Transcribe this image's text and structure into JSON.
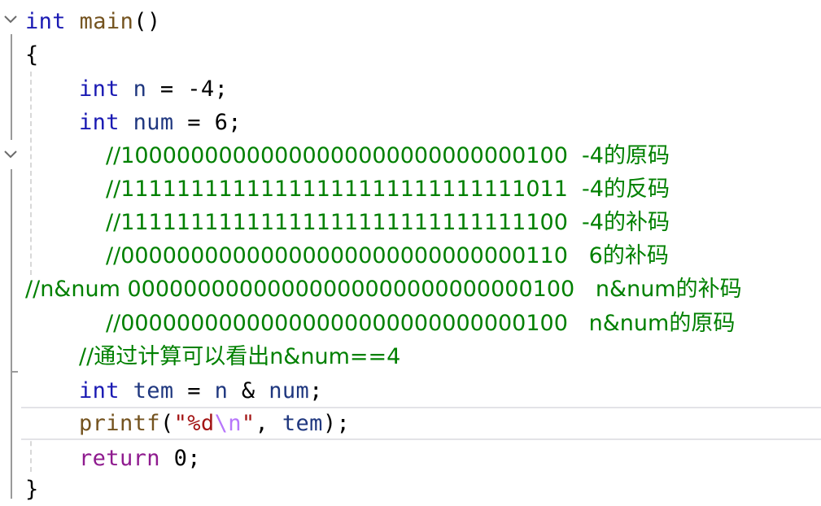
{
  "code": {
    "l1": {
      "kw": "int",
      "fn": "main",
      "p": "()"
    },
    "l2": {
      "p": "{"
    },
    "l3": {
      "kw": "int",
      "id": "n",
      "op": " = ",
      "num": "-4",
      "end": ";"
    },
    "l4": {
      "kw": "int",
      "id": "num",
      "op": " = ",
      "num": "6",
      "end": ";"
    },
    "l5": {
      "c": "//10000000000000000000000000000100  -4的原码"
    },
    "l6": {
      "c": "//11111111111111111111111111111011  -4的反码"
    },
    "l7": {
      "c": "//11111111111111111111111111111100  -4的补码"
    },
    "l8": {
      "c": "//00000000000000000000000000000110   6的补码"
    },
    "l9": {
      "c": "//n&num 00000000000000000000000000000100   n&num的补码"
    },
    "l10": {
      "c": "//00000000000000000000000000000100   n&num的原码"
    },
    "l11": {
      "c": "//通过计算可以看出n&num==4"
    },
    "l12": {
      "kw": "int",
      "id": "tem",
      "op": " = ",
      "a": "n",
      "amp": " & ",
      "b": "num",
      "end": ";"
    },
    "l13": {
      "fn": "printf",
      "p1": "(",
      "s1": "\"%d",
      "esc": "\\n",
      "s2": "\"",
      "comma": ", ",
      "id": "tem",
      "p2": ");"
    },
    "l14": {
      "kw": "return",
      "num": "0",
      "end": ";"
    },
    "l15": {
      "p": "}"
    }
  }
}
